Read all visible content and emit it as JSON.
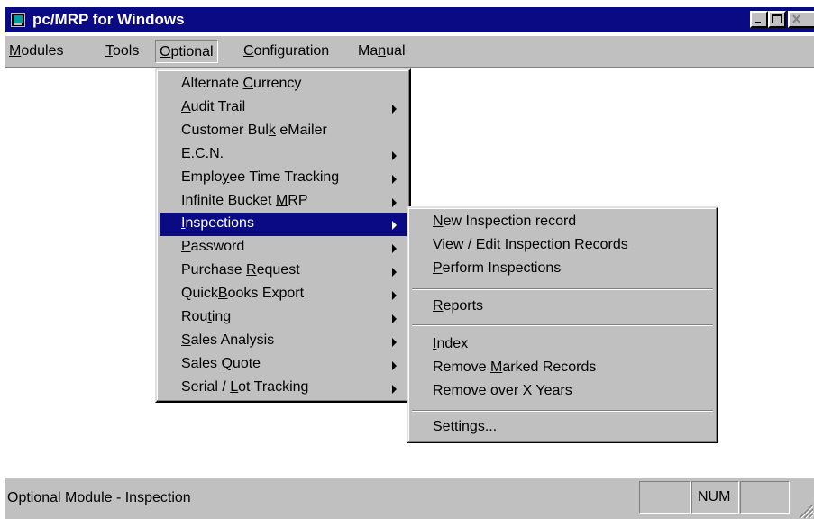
{
  "window": {
    "title": "pc/MRP for Windows"
  },
  "menubar": [
    {
      "label": "Modules",
      "accel": "M"
    },
    {
      "label": "Tools",
      "accel": "T"
    },
    {
      "label": "Optional",
      "accel": "O"
    },
    {
      "label": "Configuration",
      "accel": "C"
    },
    {
      "label": "Manual",
      "accel": "n"
    }
  ],
  "optional_menu": [
    {
      "pre": "Alternate ",
      "accel": "C",
      "post": "urrency"
    },
    {
      "pre": "",
      "accel": "A",
      "post": "udit Trail"
    },
    {
      "pre": "Customer Bul",
      "accel": "k",
      "post": " eMailer"
    },
    {
      "pre": "",
      "accel": "E",
      "post": ".C.N."
    },
    {
      "pre": "Emplo",
      "accel": "y",
      "post": "ee Time Tracking"
    },
    {
      "pre": "Infinite Bucket ",
      "accel": "M",
      "post": "RP"
    },
    {
      "pre": "",
      "accel": "I",
      "post": "nspections"
    },
    {
      "pre": "",
      "accel": "P",
      "post": "assword"
    },
    {
      "pre": "Purchase ",
      "accel": "R",
      "post": "equest"
    },
    {
      "pre": "Quick",
      "accel": "B",
      "post": "ooks Export"
    },
    {
      "pre": "Rou",
      "accel": "t",
      "post": "ing"
    },
    {
      "pre": "",
      "accel": "S",
      "post": "ales Analysis"
    },
    {
      "pre": "Sales ",
      "accel": "Q",
      "post": "uote"
    },
    {
      "pre": "Serial / ",
      "accel": "L",
      "post": "ot Tracking"
    }
  ],
  "inspections_menu": [
    {
      "pre": "",
      "accel": "N",
      "post": "ew Inspection record"
    },
    {
      "pre": "View / ",
      "accel": "E",
      "post": "dit Inspection Records"
    },
    {
      "pre": "",
      "accel": "P",
      "post": "erform Inspections"
    },
    {
      "pre": "",
      "accel": "R",
      "post": "eports"
    },
    {
      "pre": "",
      "accel": "I",
      "post": "ndex"
    },
    {
      "pre": "Remove ",
      "accel": "M",
      "post": "arked Records"
    },
    {
      "pre": "Remove over ",
      "accel": "X",
      "post": " Years"
    },
    {
      "pre": "",
      "accel": "S",
      "post": "ettings..."
    }
  ],
  "statusbar": {
    "text": "Optional Module - Inspection",
    "num": "NUM"
  }
}
